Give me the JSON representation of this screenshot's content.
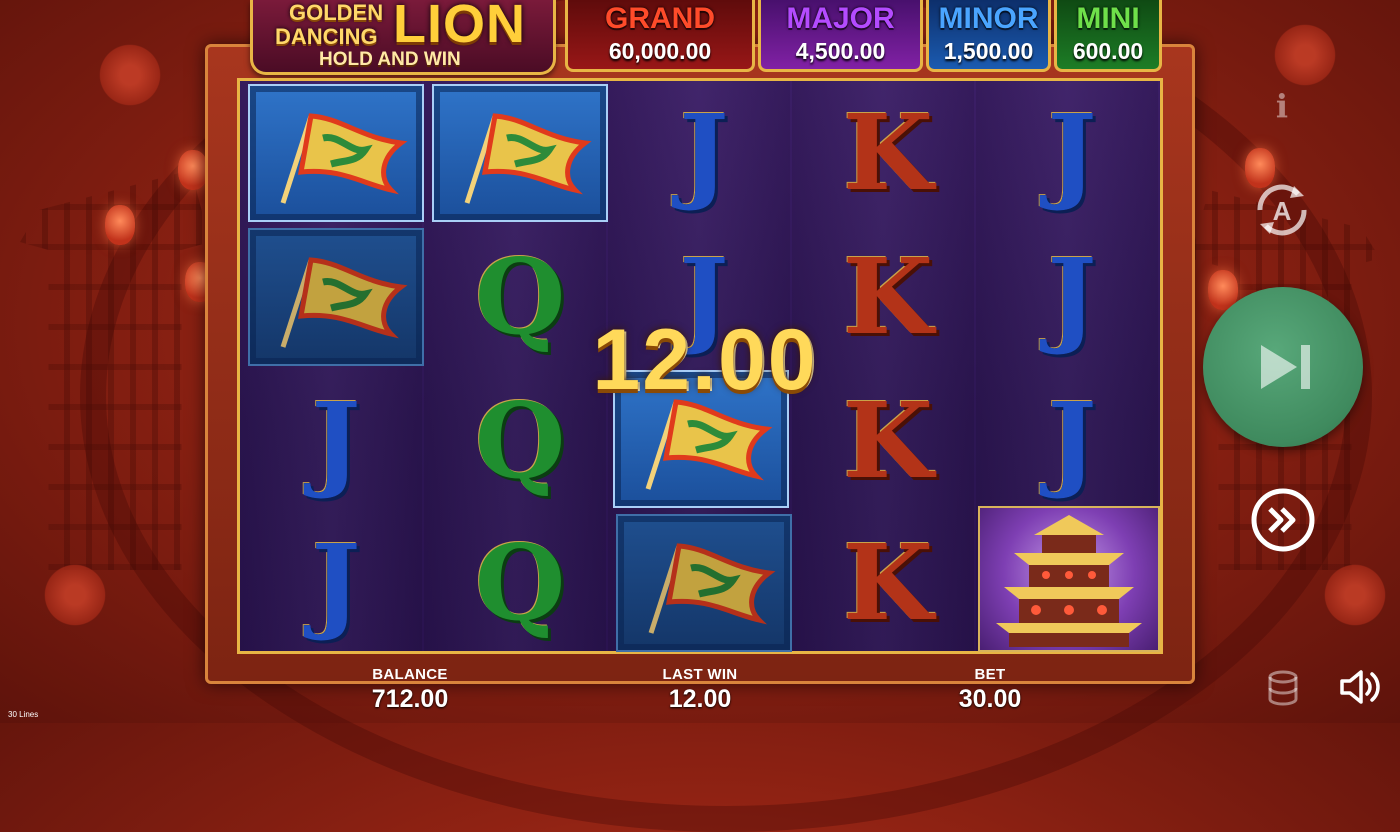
{
  "logo": {
    "line1": "GOLDEN",
    "line2": "DANCING",
    "line3": "LION",
    "subtitle": "HOLD AND WIN"
  },
  "jackpots": [
    {
      "name": "GRAND",
      "value": "60,000.00",
      "color": "#ff4b2a"
    },
    {
      "name": "MAJOR",
      "value": "4,500.00",
      "color": "#b44bff"
    },
    {
      "name": "MINOR",
      "value": "1,500.00",
      "color": "#4aa5ff"
    },
    {
      "name": "MINI",
      "value": "600.00",
      "color": "#6fe04a"
    }
  ],
  "reels": {
    "grid": [
      [
        "flag",
        "flag",
        "J",
        "K",
        "J"
      ],
      [
        "flag-dim",
        "Q",
        "J",
        "K",
        "J"
      ],
      [
        "J",
        "Q",
        "flag",
        "K",
        "J"
      ],
      [
        "J",
        "Q",
        "flag-dim",
        "K",
        "temple"
      ]
    ],
    "symbols": {
      "r0c2": "J",
      "r0c3": "K",
      "r0c4": "J",
      "r1c1": "Q",
      "r1c2": "J",
      "r1c3": "K",
      "r1c4": "J",
      "r2c0": "J",
      "r2c1": "Q",
      "r2c3": "K",
      "r2c4": "J",
      "r3c0": "J",
      "r3c1": "Q",
      "r3c3": "K"
    }
  },
  "win_amount": "12.00",
  "bottom_bar": {
    "balance_label": "BALANCE",
    "balance_value": "712.00",
    "last_win_label": "LAST WIN",
    "last_win_value": "12.00",
    "bet_label": "BET",
    "bet_value": "30.00",
    "lines_label": "30 Lines"
  },
  "controls": {
    "info": "i",
    "autoplay_letter": "A",
    "spin_button_color": "#4d9c6e",
    "icons": [
      "info-icon",
      "autoplay-icon",
      "skip-forward-icon",
      "turbo-icon",
      "history-icon",
      "sound-icon"
    ]
  }
}
